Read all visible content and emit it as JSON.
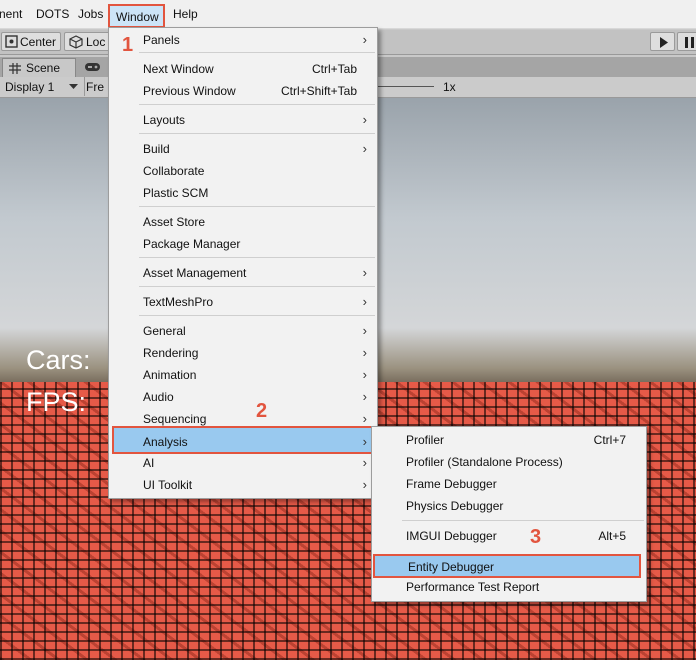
{
  "menubar": {
    "items": [
      "nent",
      "DOTS",
      "Jobs",
      "Window",
      "Help"
    ],
    "active_index": 3
  },
  "toolbar": {
    "center_label": "Center",
    "local_label": "Loc",
    "play_icon": "play-icon",
    "pause_icon": "pause-icon"
  },
  "tabs": {
    "scene_label": "Scene",
    "game_icon": "gamepad-icon"
  },
  "game_bar": {
    "display_label": "Display 1",
    "resolution_label": "Fre",
    "scale_label": "1x"
  },
  "hud": {
    "cars_label": "Cars:",
    "fps_label": "FPS:"
  },
  "window_menu": {
    "items": [
      {
        "label": "Panels",
        "shortcut": "",
        "submenu": true
      },
      {
        "label": "Next Window",
        "shortcut": "Ctrl+Tab",
        "submenu": false
      },
      {
        "label": "Previous Window",
        "shortcut": "Ctrl+Shift+Tab",
        "submenu": false
      },
      {
        "label": "Layouts",
        "shortcut": "",
        "submenu": true
      },
      {
        "label": "Build",
        "shortcut": "",
        "submenu": true
      },
      {
        "label": "Collaborate",
        "shortcut": "",
        "submenu": false
      },
      {
        "label": "Plastic SCM",
        "shortcut": "",
        "submenu": false
      },
      {
        "label": "Asset Store",
        "shortcut": "",
        "submenu": false
      },
      {
        "label": "Package Manager",
        "shortcut": "",
        "submenu": false
      },
      {
        "label": "Asset Management",
        "shortcut": "",
        "submenu": true
      },
      {
        "label": "TextMeshPro",
        "shortcut": "",
        "submenu": true
      },
      {
        "label": "General",
        "shortcut": "",
        "submenu": true
      },
      {
        "label": "Rendering",
        "shortcut": "",
        "submenu": true
      },
      {
        "label": "Animation",
        "shortcut": "",
        "submenu": true
      },
      {
        "label": "Audio",
        "shortcut": "",
        "submenu": true
      },
      {
        "label": "Sequencing",
        "shortcut": "",
        "submenu": true
      },
      {
        "label": "Analysis",
        "shortcut": "",
        "submenu": true
      },
      {
        "label": "AI",
        "shortcut": "",
        "submenu": true
      },
      {
        "label": "UI Toolkit",
        "shortcut": "",
        "submenu": true
      }
    ]
  },
  "analysis_menu": {
    "items": [
      {
        "label": "Profiler",
        "shortcut": "Ctrl+7"
      },
      {
        "label": "Profiler (Standalone Process)",
        "shortcut": ""
      },
      {
        "label": "Frame Debugger",
        "shortcut": ""
      },
      {
        "label": "Physics Debugger",
        "shortcut": ""
      },
      {
        "label": "IMGUI Debugger",
        "shortcut": "Alt+5"
      },
      {
        "label": "Entity Debugger",
        "shortcut": ""
      },
      {
        "label": "Performance Test Report",
        "shortcut": ""
      }
    ]
  },
  "step_badges": [
    "1",
    "2",
    "3"
  ],
  "colors": {
    "highlight_border": "#e2553f",
    "highlight_fill": "#99c9ef",
    "badge": "#e2553f"
  }
}
